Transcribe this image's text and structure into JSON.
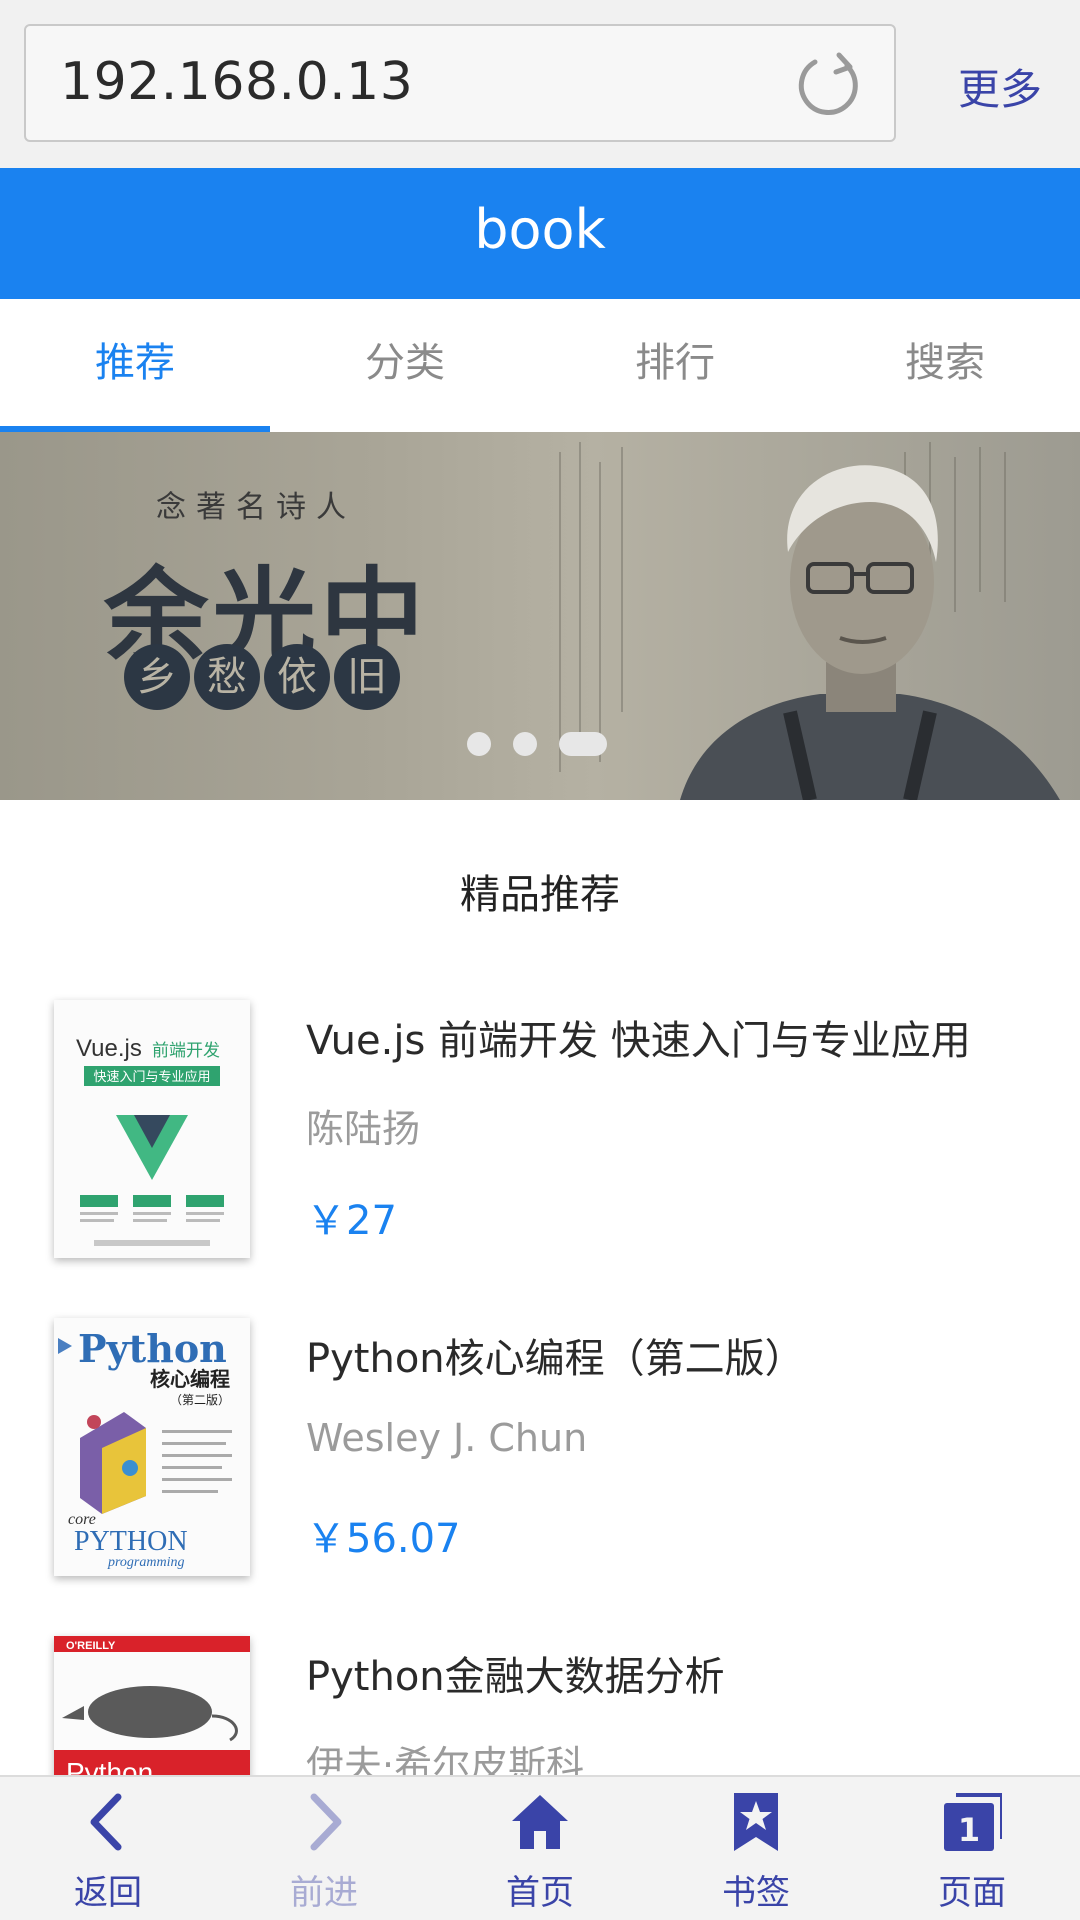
{
  "browser": {
    "url": "192.168.0.13",
    "more_label": "更多"
  },
  "header": {
    "title": "book"
  },
  "tabs": [
    {
      "label": "推荐",
      "active": true
    },
    {
      "label": "分类",
      "active": false
    },
    {
      "label": "排行",
      "active": false
    },
    {
      "label": "搜索",
      "active": false
    }
  ],
  "banner": {
    "subtitle": "念著名诗人",
    "title": "余光中",
    "chips": [
      "乡",
      "愁",
      "依",
      "旧"
    ],
    "slide_count": 3,
    "active_slide": 3
  },
  "section": {
    "title": "精品推荐"
  },
  "books": [
    {
      "title": "Vue.js 前端开发 快速入门与专业应用",
      "author": "陈陆扬",
      "price": "￥27",
      "cover": {
        "title": "Vue.js",
        "title_cn": "前端开发",
        "subtitle": "快速入门与专业应用"
      }
    },
    {
      "title": "Python核心编程（第二版）",
      "author": "Wesley J. Chun",
      "price": "￥56.07",
      "cover": {
        "title": "Python",
        "title_cn": "核心编程",
        "edition": "（第二版）",
        "core": "core",
        "python": "PYTHON",
        "programming": "programming"
      }
    },
    {
      "title": "Python金融大数据分析",
      "author": "伊夫·希尔皮斯科",
      "price": "",
      "cover": {
        "publisher": "O'REILLY",
        "title": "Python"
      }
    }
  ],
  "bottom_nav": [
    {
      "label": "返回",
      "icon": "chevron-left-icon",
      "enabled": true
    },
    {
      "label": "前进",
      "icon": "chevron-right-icon",
      "enabled": false
    },
    {
      "label": "首页",
      "icon": "home-icon",
      "enabled": true
    },
    {
      "label": "书签",
      "icon": "bookmark-star-icon",
      "enabled": true
    },
    {
      "label": "页面",
      "icon": "pages-icon",
      "enabled": true,
      "badge": "1"
    }
  ],
  "colors": {
    "accent": "#1a82f0",
    "nav": "#3a44a8",
    "nav_disabled": "#a8abd3",
    "muted_text": "#9b9b9b"
  }
}
